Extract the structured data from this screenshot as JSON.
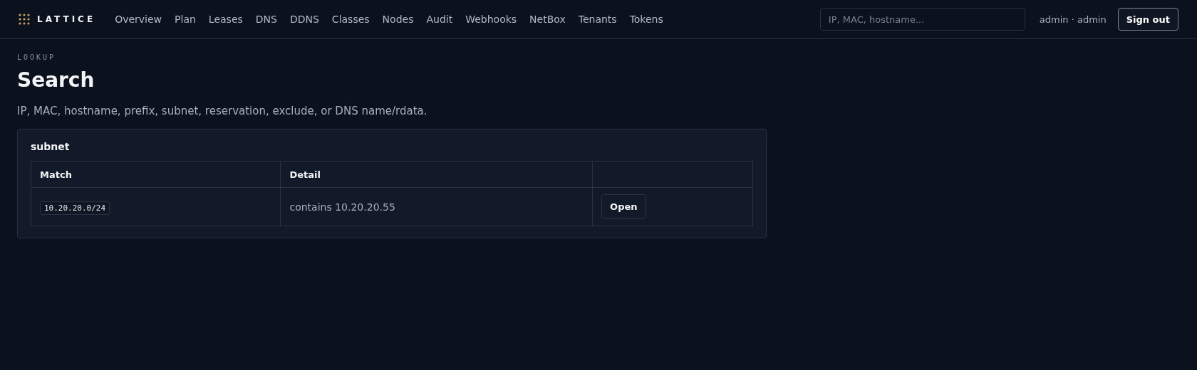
{
  "brand": "LATTICE",
  "nav": [
    {
      "label": "Overview",
      "selected": false
    },
    {
      "label": "Plan",
      "selected": false
    },
    {
      "label": "Leases",
      "selected": false
    },
    {
      "label": "DNS",
      "selected": false
    },
    {
      "label": "DDNS",
      "selected": false
    },
    {
      "label": "Classes",
      "selected": false
    },
    {
      "label": "Nodes",
      "selected": false
    },
    {
      "label": "Audit",
      "selected": false
    },
    {
      "label": "Webhooks",
      "selected": false
    },
    {
      "label": "NetBox",
      "selected": false
    },
    {
      "label": "Tenants",
      "selected": false
    },
    {
      "label": "Tokens",
      "selected": false
    }
  ],
  "search": {
    "placeholder": "IP, MAC, hostname..."
  },
  "user": "admin · admin",
  "sign_out": "Sign out",
  "eyebrow": "LOOKUP",
  "title": "Search",
  "subtitle": "IP, MAC, hostname, prefix, subnet, reservation, exclude, or DNS name/rdata.",
  "results": [
    {
      "heading": "subnet",
      "columns": [
        "Match",
        "Detail"
      ],
      "rows": [
        {
          "match": "10.20.20.0/24",
          "detail": "contains 10.20.20.55",
          "action": "Open"
        }
      ]
    }
  ]
}
